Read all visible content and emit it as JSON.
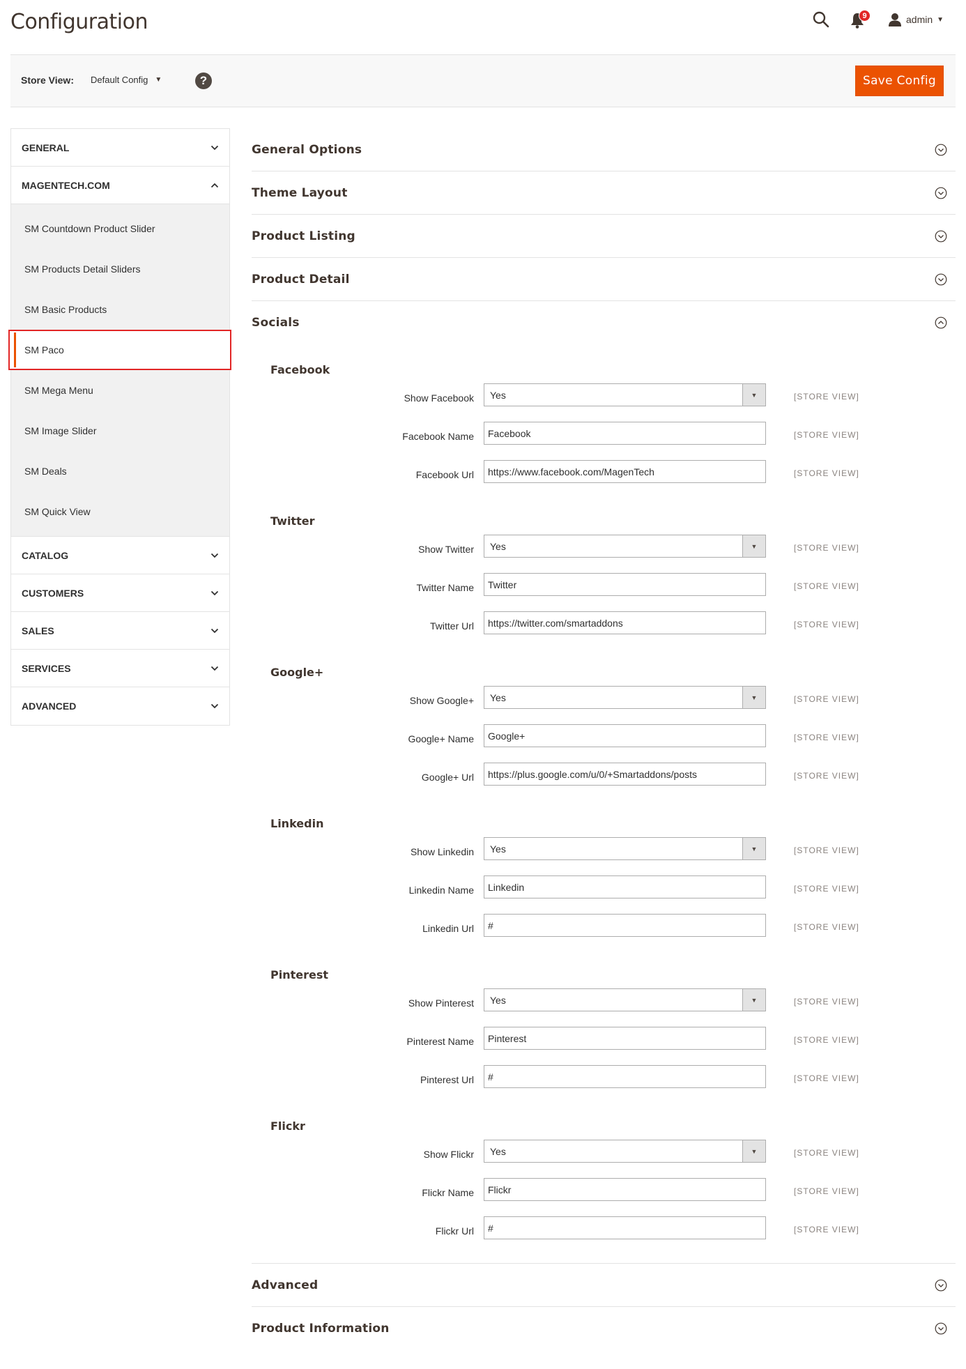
{
  "header": {
    "title": "Configuration",
    "notification_count": "9",
    "user_name": "admin"
  },
  "store_bar": {
    "label": "Store View:",
    "value": "Default Config",
    "save_label": "Save Config"
  },
  "sidebar": {
    "general": "GENERAL",
    "magentech": "MAGENTECH.COM",
    "items": [
      "SM Countdown Product Slider",
      "SM Products Detail Sliders",
      "SM Basic Products",
      "SM Paco",
      "SM Mega Menu",
      "SM Image Slider",
      "SM Deals",
      "SM Quick View"
    ],
    "catalog": "CATALOG",
    "customers": "CUSTOMERS",
    "sales": "SALES",
    "services": "SERVICES",
    "advanced": "ADVANCED"
  },
  "sections": {
    "general_options": "General Options",
    "theme_layout": "Theme Layout",
    "product_listing": "Product Listing",
    "product_detail": "Product Detail",
    "socials": "Socials",
    "advanced": "Advanced",
    "product_information": "Product Information"
  },
  "scope_label": "[STORE VIEW]",
  "socials": [
    {
      "title": "Facebook",
      "show_label": "Show Facebook",
      "show_value": "Yes",
      "name_label": "Facebook Name",
      "name_value": "Facebook",
      "url_label": "Facebook Url",
      "url_value": "https://www.facebook.com/MagenTech"
    },
    {
      "title": "Twitter",
      "show_label": "Show Twitter",
      "show_value": "Yes",
      "name_label": "Twitter Name",
      "name_value": "Twitter",
      "url_label": "Twitter Url",
      "url_value": "https://twitter.com/smartaddons"
    },
    {
      "title": "Google+",
      "show_label": "Show Google+",
      "show_value": "Yes",
      "name_label": "Google+ Name",
      "name_value": "Google+",
      "url_label": "Google+ Url",
      "url_value": "https://plus.google.com/u/0/+Smartaddons/posts"
    },
    {
      "title": "Linkedin",
      "show_label": "Show Linkedin",
      "show_value": "Yes",
      "name_label": "Linkedin Name",
      "name_value": "Linkedin",
      "url_label": "Linkedin Url",
      "url_value": "#"
    },
    {
      "title": "Pinterest",
      "show_label": "Show Pinterest",
      "show_value": "Yes",
      "name_label": "Pinterest Name",
      "name_value": "Pinterest",
      "url_label": "Pinterest Url",
      "url_value": "#"
    },
    {
      "title": "Flickr",
      "show_label": "Show Flickr",
      "show_value": "Yes",
      "name_label": "Flickr Name",
      "name_value": "Flickr",
      "url_label": "Flickr Url",
      "url_value": "#"
    }
  ],
  "colors": {
    "accent": "#eb5202",
    "highlight": "#e22626",
    "badge": "#e22626"
  }
}
